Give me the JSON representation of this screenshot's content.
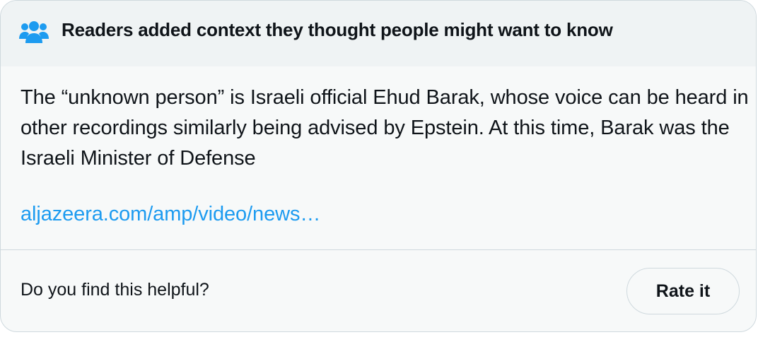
{
  "header": {
    "icon": "people-group-icon",
    "title": "Readers added context they thought people might want to know",
    "icon_color": "#1d9bf0"
  },
  "note": {
    "text": "The “unknown person” is Israeli official Ehud Barak, whose voice can be heard in other recordings similarly being advised by Epstein. At this time, Barak was the Israeli Minister of Defense",
    "link_text": "aljazeera.com/amp/video/news…",
    "link_color": "#1d9bf0"
  },
  "footer": {
    "question": "Do you find this helpful?",
    "rate_button_label": "Rate it"
  }
}
